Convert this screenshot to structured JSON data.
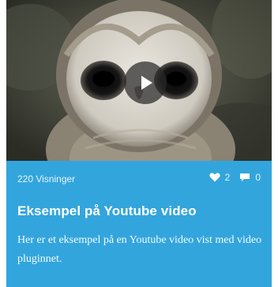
{
  "post": {
    "views_text": "220 Visninger",
    "likes_count": "2",
    "comments_count": "0",
    "title": "Eksempel på Youtube video",
    "description": "Her er et eksempel på en Youtube video vist med video pluginnet."
  },
  "icons": {
    "play": "play-icon",
    "like": "heart-icon",
    "comment": "comment-icon"
  },
  "colors": {
    "card_background": "#33a5dd",
    "text": "#ffffff"
  }
}
